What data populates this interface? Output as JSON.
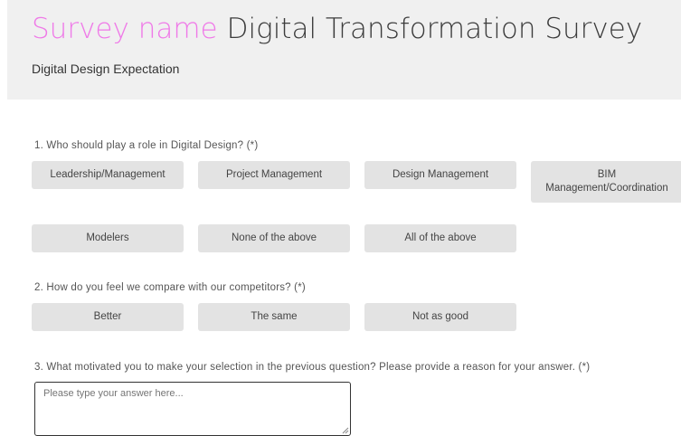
{
  "header": {
    "title_prefix": "Survey name",
    "title": "Digital Transformation Survey",
    "subtitle": "Digital Design Expectation"
  },
  "questions": [
    {
      "label": "1. Who should play a role in Digital Design? (*)",
      "options": [
        "Leadership/Management",
        "Project Management",
        "Design Management",
        "BIM Management/Coordination",
        "Modelers",
        "None of the above",
        "All of the above"
      ]
    },
    {
      "label": "2. How do you feel we compare with our competitors? (*)",
      "options": [
        "Better",
        "The same",
        "Not as good"
      ]
    },
    {
      "label": "3. What motivated you to make your selection in the previous question? Please provide a reason for your answer. (*)",
      "placeholder": "Please type your answer here..."
    }
  ]
}
